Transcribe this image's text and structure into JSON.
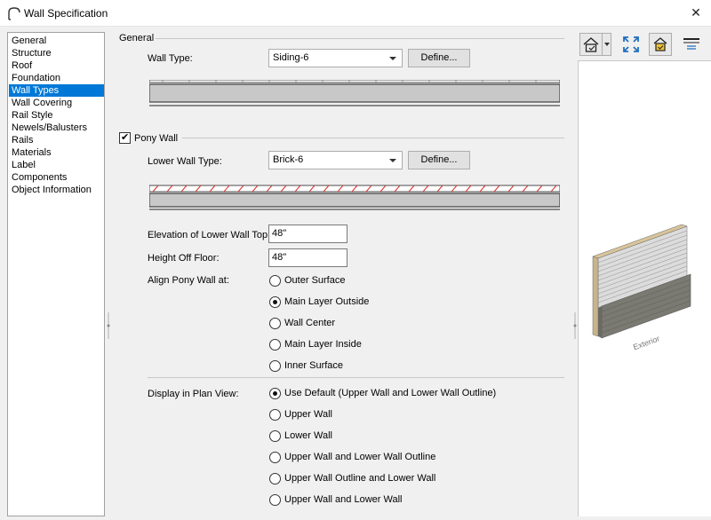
{
  "window": {
    "title": "Wall Specification",
    "close_glyph": "✕",
    "icon": "wall-arch-icon"
  },
  "sidebar": {
    "items": [
      {
        "label": "General"
      },
      {
        "label": "Structure"
      },
      {
        "label": "Roof"
      },
      {
        "label": "Foundation"
      },
      {
        "label": "Wall Types",
        "selected": true
      },
      {
        "label": "Wall Covering"
      },
      {
        "label": "Rail Style"
      },
      {
        "label": "Newels/Balusters"
      },
      {
        "label": "Rails"
      },
      {
        "label": "Materials"
      },
      {
        "label": "Label"
      },
      {
        "label": "Components"
      },
      {
        "label": "Object Information"
      }
    ]
  },
  "general": {
    "section_label": "General",
    "wall_type_label": "Wall Type:",
    "wall_type_value": "Siding-6",
    "define_label": "Define..."
  },
  "pony_wall": {
    "checkbox_label": "Pony Wall",
    "checked": true,
    "check_glyph": "✔",
    "lower_wall_type_label": "Lower Wall Type:",
    "lower_wall_type_value": "Brick-6",
    "define_label": "Define...",
    "elevation_label": "Elevation of Lower Wall Top:",
    "elevation_value": "48\"",
    "height_off_floor_label": "Height Off Floor:",
    "height_off_floor_value": "48\"",
    "align_label": "Align Pony Wall at:",
    "align_options": [
      {
        "label": "Outer Surface",
        "selected": false
      },
      {
        "label": "Main Layer Outside",
        "selected": true
      },
      {
        "label": "Wall Center",
        "selected": false
      },
      {
        "label": "Main Layer Inside",
        "selected": false
      },
      {
        "label": "Inner Surface",
        "selected": false
      }
    ],
    "display_label": "Display in Plan View:",
    "display_options": [
      {
        "label": "Use Default (Upper Wall and Lower Wall Outline)",
        "selected": true
      },
      {
        "label": "Upper Wall",
        "selected": false
      },
      {
        "label": "Lower Wall",
        "selected": false
      },
      {
        "label": "Upper Wall and Lower Wall Outline",
        "selected": false
      },
      {
        "label": "Upper Wall Outline and Lower Wall",
        "selected": false
      },
      {
        "label": "Upper Wall and Lower Wall",
        "selected": false
      }
    ]
  },
  "preview": {
    "exterior_label": "Exterior",
    "toolbar": [
      "camera-view-icon",
      "camera-dropdown-icon",
      "fill-window-icon",
      "color-on-icon",
      "show-options-icon"
    ]
  },
  "colors": {
    "selection": "#0078d7",
    "brick_hatch": "#d9302c",
    "wall_fill": "#c8c8c8",
    "siding": "#dcdcdc",
    "brick": "#7a7a72"
  }
}
